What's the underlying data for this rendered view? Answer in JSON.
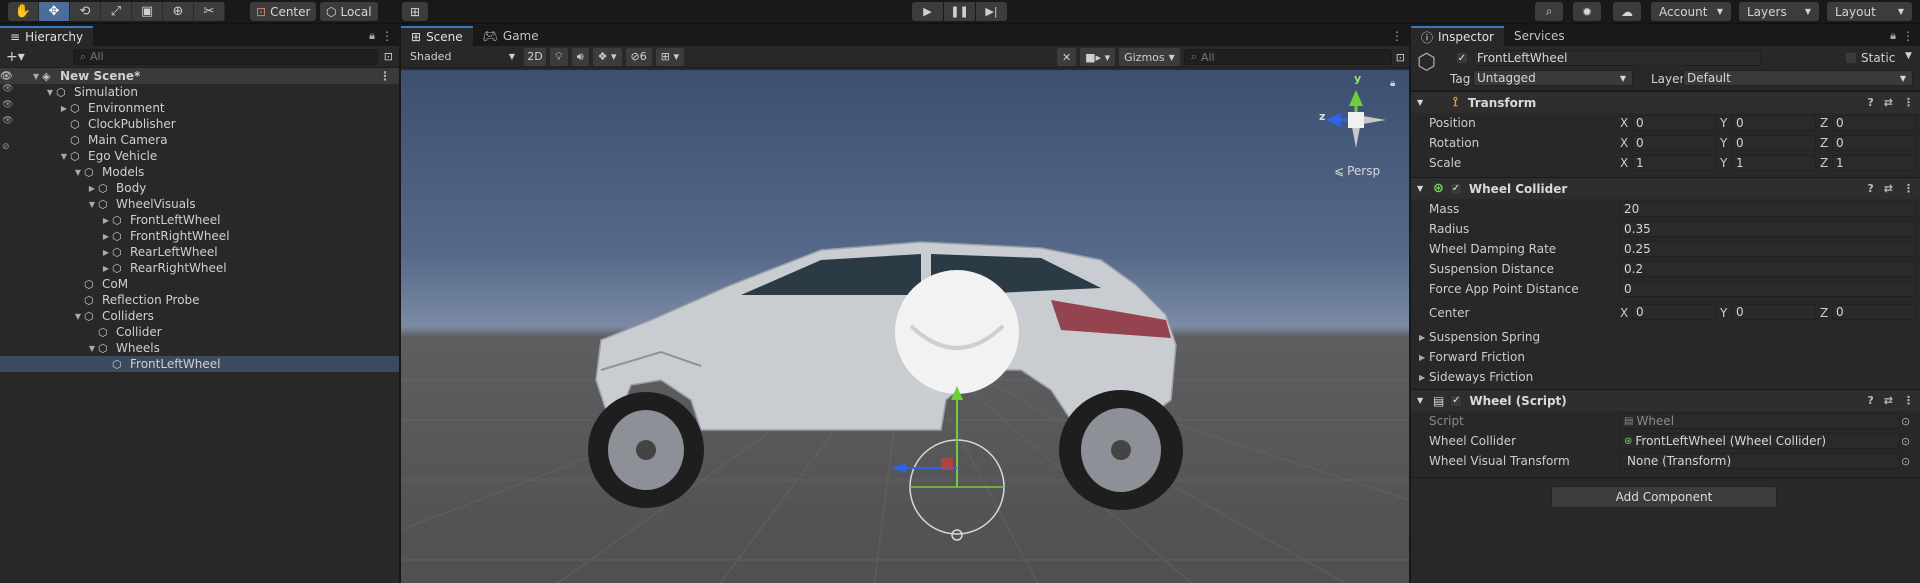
{
  "toolbar": {
    "tools": [
      "hand-tool",
      "move-tool",
      "rotate-tool",
      "rect-scale-tool",
      "rect-tool",
      "transform-tool",
      "custom-tool"
    ],
    "pivot_mode": "Center",
    "pivot_rotation": "Local",
    "account": "Account",
    "layers": "Layers",
    "layout": "Layout"
  },
  "hierarchy": {
    "tab": "Hierarchy",
    "search_placeholder": "All",
    "scene": "New Scene*",
    "items": [
      {
        "label": "Simulation",
        "depth": 1,
        "expanded": true
      },
      {
        "label": "Environment",
        "depth": 2,
        "expanded": false
      },
      {
        "label": "ClockPublisher",
        "depth": 2,
        "expanded": null
      },
      {
        "label": "Main Camera",
        "depth": 2,
        "expanded": null
      },
      {
        "label": "Ego Vehicle",
        "depth": 2,
        "expanded": true
      },
      {
        "label": "Models",
        "depth": 3,
        "expanded": true
      },
      {
        "label": "Body",
        "depth": 4,
        "expanded": false
      },
      {
        "label": "WheelVisuals",
        "depth": 4,
        "expanded": true
      },
      {
        "label": "FrontLeftWheel",
        "depth": 5,
        "expanded": false
      },
      {
        "label": "FrontRightWheel",
        "depth": 5,
        "expanded": false
      },
      {
        "label": "RearLeftWheel",
        "depth": 5,
        "expanded": false
      },
      {
        "label": "RearRightWheel",
        "depth": 5,
        "expanded": false
      },
      {
        "label": "CoM",
        "depth": 3,
        "expanded": null
      },
      {
        "label": "Reflection Probe",
        "depth": 3,
        "expanded": null
      },
      {
        "label": "Colliders",
        "depth": 3,
        "expanded": true
      },
      {
        "label": "Collider",
        "depth": 4,
        "expanded": null
      },
      {
        "label": "Wheels",
        "depth": 4,
        "expanded": true
      },
      {
        "label": "FrontLeftWheel",
        "depth": 5,
        "expanded": null,
        "selected": true
      }
    ]
  },
  "scene_view": {
    "tabs": [
      "Scene",
      "Game"
    ],
    "shading": "Shaded",
    "mode_2d": "2D",
    "hidden_count": "6",
    "gizmos": "Gizmos",
    "search_placeholder": "All",
    "persp": "Persp",
    "axis_y": "y",
    "axis_z": "z"
  },
  "inspector": {
    "tabs": [
      "Inspector",
      "Services"
    ],
    "object_name": "FrontLeftWheel",
    "static_label": "Static",
    "tag_label": "Tag",
    "tag_value": "Untagged",
    "layer_label": "Layer",
    "layer_value": "Default",
    "transform": {
      "title": "Transform",
      "rows": [
        {
          "label": "Position",
          "x": "0",
          "y": "0",
          "z": "0"
        },
        {
          "label": "Rotation",
          "x": "0",
          "y": "0",
          "z": "0"
        },
        {
          "label": "Scale",
          "x": "1",
          "y": "1",
          "z": "1"
        }
      ]
    },
    "wheel_collider": {
      "title": "Wheel Collider",
      "fields": [
        {
          "label": "Mass",
          "value": "20"
        },
        {
          "label": "Radius",
          "value": "0.35"
        },
        {
          "label": "Wheel Damping Rate",
          "value": "0.25"
        },
        {
          "label": "Suspension Distance",
          "value": "0.2"
        },
        {
          "label": "Force App Point Distance",
          "value": "0"
        }
      ],
      "center": {
        "label": "Center",
        "x": "0",
        "y": "0",
        "z": "0"
      },
      "foldouts": [
        "Suspension Spring",
        "Forward Friction",
        "Sideways Friction"
      ]
    },
    "wheel_script": {
      "title": "Wheel (Script)",
      "rows": [
        {
          "label": "Script",
          "value": "Wheel"
        },
        {
          "label": "Wheel Collider",
          "value": "FrontLeftWheel (Wheel Collider)"
        },
        {
          "label": "Wheel Visual Transform",
          "value": "None (Transform)"
        }
      ]
    },
    "axis_labels": [
      "X",
      "Y",
      "Z"
    ],
    "add_component": "Add Component"
  },
  "colors": {
    "selection": "#3c4a5e",
    "accent": "#3a79bb",
    "gizmo_y": "#6fce3a",
    "gizmo_z": "#2e63e8",
    "gizmo_x": "#d23a3a"
  }
}
